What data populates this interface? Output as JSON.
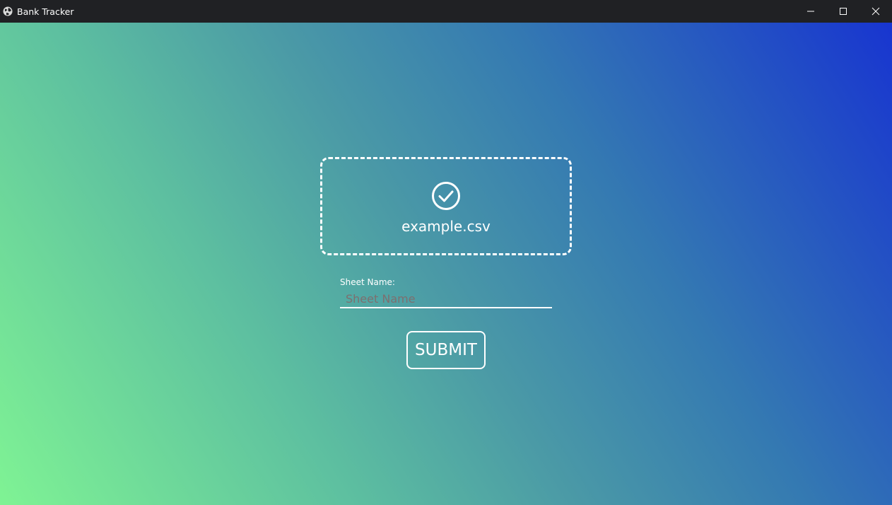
{
  "window": {
    "title": "Bank Tracker",
    "app_icon": "globe-icon",
    "controls": [
      "minimize-icon",
      "maximize-icon",
      "close-icon"
    ]
  },
  "dropzone": {
    "status_icon": "check-circle-icon",
    "file_name": "example.csv"
  },
  "form": {
    "sheet_label": "Sheet Name:",
    "sheet_placeholder": "Sheet Name",
    "sheet_value": "",
    "submit_label": "SUBMIT"
  },
  "colors": {
    "titlebar": "#202124",
    "gradient_start": "#7ff394",
    "gradient_mid": "#4b9aa6",
    "gradient_end": "#1835d0",
    "placeholder": "#7d6f6f",
    "foreground": "#ffffff"
  }
}
